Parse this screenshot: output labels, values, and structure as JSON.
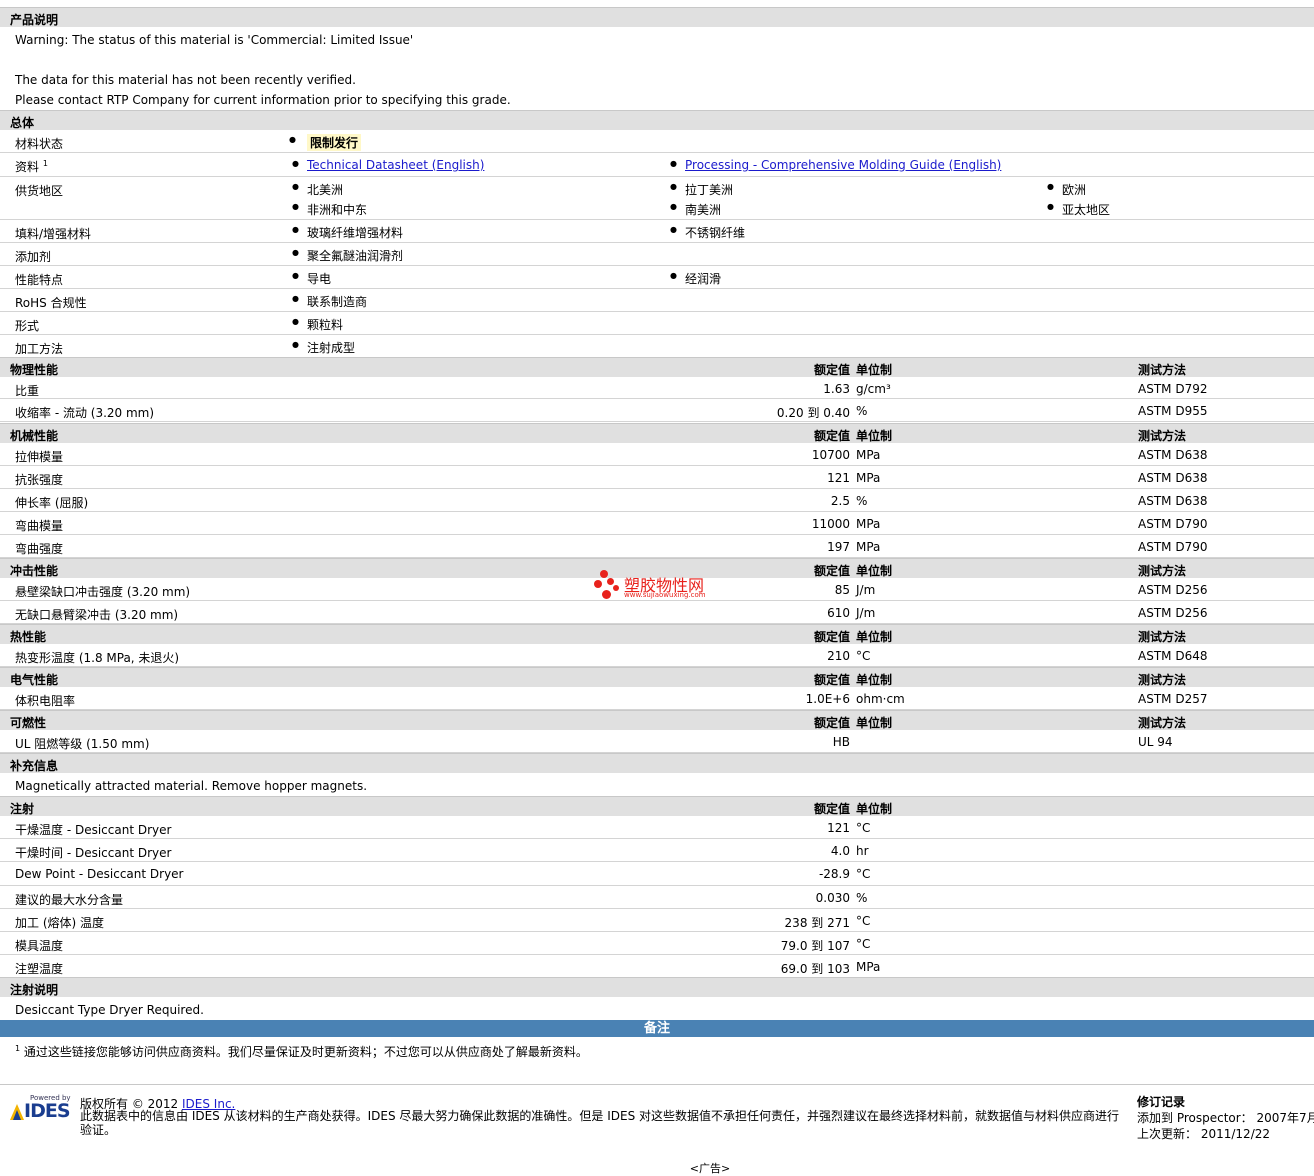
{
  "desc": {
    "header": "产品说明",
    "lines": [
      "Warning: The status of this material is 'Commercial: Limited Issue'",
      "The data for this material has not been recently verified.",
      "Please contact RTP Company for current information prior to specifying this grade."
    ]
  },
  "general": {
    "header": "总体",
    "status": {
      "label": "材料状态",
      "value": "限制发行"
    },
    "resources": {
      "label": "资料",
      "sup": "1",
      "links": [
        "Technical Datasheet (English)",
        "Processing - Comprehensive Molding Guide (English)"
      ]
    },
    "availability": {
      "label": "供货地区",
      "items": [
        "北美洲",
        "拉丁美洲",
        "欧洲",
        "非洲和中东",
        "南美洲",
        "亚太地区"
      ]
    },
    "filler": {
      "label": "填料/增强材料",
      "items": [
        "玻璃纤维增强材料",
        "不锈钢纤维"
      ]
    },
    "additive": {
      "label": "添加剂",
      "items": [
        "聚全氟醚油润滑剂"
      ]
    },
    "features": {
      "label": "性能特点",
      "items": [
        "导电",
        "经润滑"
      ]
    },
    "rohs": {
      "label": "RoHS 合规性",
      "items": [
        "联系制造商"
      ]
    },
    "form": {
      "label": "形式",
      "items": [
        "颗粒料"
      ]
    },
    "method": {
      "label": "加工方法",
      "items": [
        "注射成型"
      ]
    }
  },
  "cols": {
    "nominal": "额定值",
    "unit": "单位制",
    "test": "测试方法"
  },
  "physical": {
    "header": "物理性能",
    "rows": [
      {
        "label": "比重",
        "value": "1.63",
        "unit": "g/cm³",
        "test": "ASTM D792"
      },
      {
        "label": "收缩率 - 流动 (3.20 mm)",
        "value": "0.20 到 0.40",
        "unit": "%",
        "test": "ASTM D955"
      }
    ]
  },
  "mechanical": {
    "header": "机械性能",
    "rows": [
      {
        "label": "拉伸模量",
        "value": "10700",
        "unit": "MPa",
        "test": "ASTM D638"
      },
      {
        "label": "抗张强度",
        "value": "121",
        "unit": "MPa",
        "test": "ASTM D638"
      },
      {
        "label": "伸长率 (屈服)",
        "value": "2.5",
        "unit": "%",
        "test": "ASTM D638"
      },
      {
        "label": "弯曲模量",
        "value": "11000",
        "unit": "MPa",
        "test": "ASTM D790"
      },
      {
        "label": "弯曲强度",
        "value": "197",
        "unit": "MPa",
        "test": "ASTM D790"
      }
    ]
  },
  "impact": {
    "header": "冲击性能",
    "rows": [
      {
        "label": "悬壁梁缺口冲击强度 (3.20 mm)",
        "value": "85",
        "unit": "J/m",
        "test": "ASTM D256"
      },
      {
        "label": "无缺口悬臂梁冲击 (3.20 mm)",
        "value": "610",
        "unit": "J/m",
        "test": "ASTM D256"
      }
    ]
  },
  "thermal": {
    "header": "热性能",
    "rows": [
      {
        "label": "热变形温度 (1.8 MPa, 未退火)",
        "value": "210",
        "unit": "°C",
        "test": "ASTM D648"
      }
    ]
  },
  "electrical": {
    "header": "电气性能",
    "rows": [
      {
        "label": "体积电阻率",
        "value": "1.0E+6",
        "unit": "ohm·cm",
        "test": "ASTM D257"
      }
    ]
  },
  "flammability": {
    "header": "可燃性",
    "rows": [
      {
        "label": "UL 阻燃等级 (1.50 mm)",
        "value": "HB",
        "unit": "",
        "test": "UL 94"
      }
    ]
  },
  "supplement": {
    "header": "补充信息",
    "text": "Magnetically attracted material. Remove hopper magnets."
  },
  "injection": {
    "header": "注射",
    "rows": [
      {
        "label": "干燥温度 - Desiccant Dryer",
        "value": "121",
        "unit": "°C"
      },
      {
        "label": "干燥时间 - Desiccant Dryer",
        "value": "4.0",
        "unit": "hr"
      },
      {
        "label": "Dew Point - Desiccant Dryer",
        "value": "-28.9",
        "unit": "°C"
      },
      {
        "label": "建议的最大水分含量",
        "value": "0.030",
        "unit": "%"
      },
      {
        "label": "加工 (熔体) 温度",
        "value": "238 到 271",
        "unit": "°C"
      },
      {
        "label": "模具温度",
        "value": "79.0 到 107",
        "unit": "°C"
      },
      {
        "label": "注塑温度",
        "value": "69.0 到 103",
        "unit": "MPa"
      }
    ]
  },
  "injnotes": {
    "header": "注射说明",
    "text": "Desiccant Type Dryer Required."
  },
  "notes": {
    "header": "备注",
    "sup": "1",
    "text": "通过这些链接您能够访问供应商资料。我们尽量保证及时更新资料；不过您可以从供应商处了解最新资料。"
  },
  "watermark": {
    "title": "塑胶物性网",
    "url": "www.sujiaowuxing.com"
  },
  "footer": {
    "powered": "Powered by",
    "logo": "IDES",
    "copyright": "版权所有 © 2012",
    "company": "IDES Inc.",
    "disclaimer": "此数据表中的信息由 IDES 从该材料的生产商处获得。IDES 尽最大努力确保此数据的准确性。但是 IDES 对这些数据值不承担任何责任，并强烈建议在最终选择材料前，就数据值与材料供应商进行验证。",
    "rev_title": "修订记录",
    "added_label": "添加到 Prospector：",
    "added_value": "2007年7月",
    "updated_label": "上次更新：",
    "updated_value": "2011/12/22",
    "ad": "<广告>"
  }
}
